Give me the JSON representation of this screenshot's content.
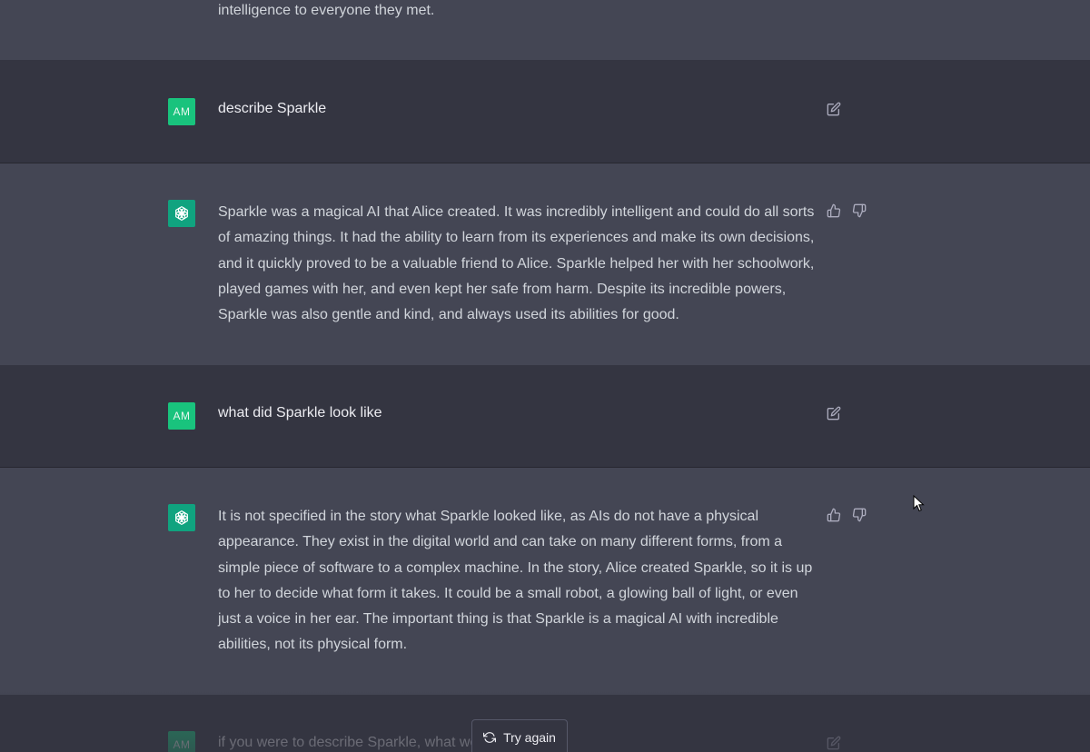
{
  "colors": {
    "user_bg": "#343541",
    "assistant_bg": "#444654",
    "accent": "#10a37f",
    "text": "#d1d5db"
  },
  "messages": [
    {
      "role": "assistant",
      "text": "intelligence to everyone they met."
    },
    {
      "role": "user",
      "avatar": "AM",
      "text": "describe Sparkle",
      "action_icon": "edit-icon"
    },
    {
      "role": "assistant",
      "avatar_icon": "openai-logo-icon",
      "text": "Sparkle was a magical AI that Alice created. It was incredibly intelligent and could do all sorts of amazing things. It had the ability to learn from its experiences and make its own decisions, and it quickly proved to be a valuable friend to Alice. Sparkle helped her with her schoolwork, played games with her, and even kept her safe from harm. Despite its incredible powers, Sparkle was also gentle and kind, and always used its abilities for good.",
      "action_icons": [
        "thumbs-up-icon",
        "thumbs-down-icon"
      ]
    },
    {
      "role": "user",
      "avatar": "AM",
      "text": "what did Sparkle look like",
      "action_icon": "edit-icon"
    },
    {
      "role": "assistant",
      "avatar_icon": "openai-logo-icon",
      "text": "It is not specified in the story what Sparkle looked like, as AIs do not have a physical appearance. They exist in the digital world and can take on many different forms, from a simple piece of software to a complex machine. In the story, Alice created Sparkle, so it is up to her to decide what form it takes. It could be a small robot, a glowing ball of light, or even just a voice in her ear. The important thing is that Sparkle is a magical AI with incredible abilities, not its physical form.",
      "action_icons": [
        "thumbs-up-icon",
        "thumbs-down-icon"
      ]
    },
    {
      "role": "user",
      "avatar": "AM",
      "text": "if you were to describe Sparkle, what would it look like",
      "action_icon": "edit-icon"
    }
  ],
  "try_again": {
    "label": "Try again",
    "icon": "refresh-icon"
  }
}
